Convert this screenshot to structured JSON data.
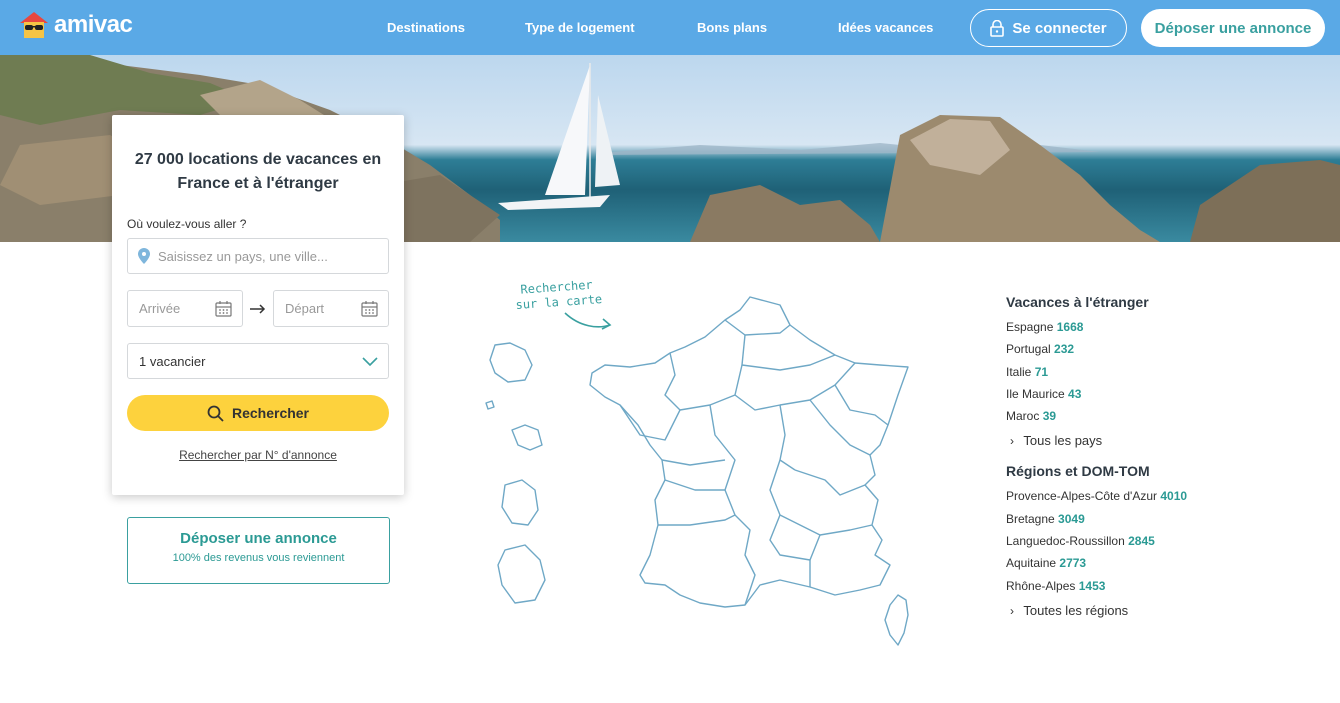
{
  "header": {
    "brand": "amivac",
    "nav": [
      "Destinations",
      "Type de logement",
      "Bons plans",
      "Idées vacances"
    ],
    "login_label": "Se connecter",
    "post_label": "Déposer une annonce"
  },
  "search": {
    "title": "27 000 locations de vacances en France et à l'étranger",
    "where_label": "Où voulez-vous aller ?",
    "where_placeholder": "Saisissez un pays, une ville...",
    "arrival_placeholder": "Arrivée",
    "departure_placeholder": "Départ",
    "guests_value": "1 vacancier",
    "search_button": "Rechercher",
    "ref_link": "Rechercher par N° d'annonce"
  },
  "post_box": {
    "title": "Déposer une annonce",
    "subtitle": "100% des revenus vous reviennent"
  },
  "map": {
    "hint_line1": "Rechercher",
    "hint_line2": "sur la carte"
  },
  "abroad": {
    "title": "Vacances à l'étranger",
    "items": [
      {
        "name": "Espagne",
        "count": "1668"
      },
      {
        "name": "Portugal",
        "count": "232"
      },
      {
        "name": "Italie",
        "count": "71"
      },
      {
        "name": "Ile Maurice",
        "count": "43"
      },
      {
        "name": "Maroc",
        "count": "39"
      }
    ],
    "more": "Tous les pays"
  },
  "regions": {
    "title": "Régions et DOM-TOM",
    "items": [
      {
        "name": "Provence-Alpes-Côte d'Azur",
        "count": "4010"
      },
      {
        "name": "Bretagne",
        "count": "3049"
      },
      {
        "name": "Languedoc-Roussillon",
        "count": "2845"
      },
      {
        "name": "Aquitaine",
        "count": "2773"
      },
      {
        "name": "Rhône-Alpes",
        "count": "1453"
      }
    ],
    "more": "Toutes les régions"
  },
  "colors": {
    "header_bg": "#5aa9e6",
    "accent_teal": "#2b9a94",
    "search_yellow": "#fdd23d"
  }
}
